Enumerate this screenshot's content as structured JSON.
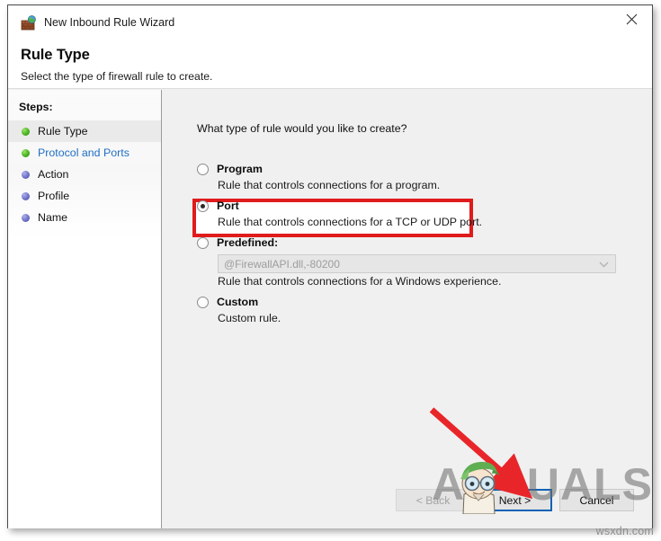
{
  "window": {
    "title": "New Inbound Rule Wizard",
    "title_icon": "firewall-brick-globe-icon",
    "close_label": "close-icon"
  },
  "header": {
    "title": "Rule Type",
    "subtitle": "Select the type of firewall rule to create."
  },
  "sidebar": {
    "heading": "Steps:",
    "items": [
      {
        "label": "Rule Type",
        "state": "current",
        "bullet": "green"
      },
      {
        "label": "Protocol and Ports",
        "state": "link",
        "bullet": "green"
      },
      {
        "label": "Action",
        "state": "pending",
        "bullet": "blue"
      },
      {
        "label": "Profile",
        "state": "pending",
        "bullet": "blue"
      },
      {
        "label": "Name",
        "state": "pending",
        "bullet": "blue"
      }
    ]
  },
  "main": {
    "question": "What type of rule would you like to create?",
    "options": [
      {
        "id": "program",
        "title": "Program",
        "description": "Rule that controls connections for a program.",
        "selected": false
      },
      {
        "id": "port",
        "title": "Port",
        "description": "Rule that controls connections for a TCP or UDP port.",
        "selected": true,
        "highlighted": true
      },
      {
        "id": "predefined",
        "title": "Predefined:",
        "description": "Rule that controls connections for a Windows experience.",
        "selected": false,
        "combo_value": "@FirewallAPI.dll,-80200",
        "combo_disabled": true
      },
      {
        "id": "custom",
        "title": "Custom",
        "description": "Custom rule.",
        "selected": false
      }
    ]
  },
  "footer": {
    "back_label": "< Back",
    "back_disabled": true,
    "next_label": "Next >",
    "next_focused": true,
    "cancel_label": "Cancel"
  },
  "annotations": {
    "highlight_color": "#e01b1b",
    "arrow_color": "#e8262a",
    "arrow_target": "next-button",
    "focus_color": "#1062b5"
  },
  "watermark": {
    "brand_text_left": "A",
    "brand_text_right": "UALS",
    "credit": "wsxdn.com"
  }
}
